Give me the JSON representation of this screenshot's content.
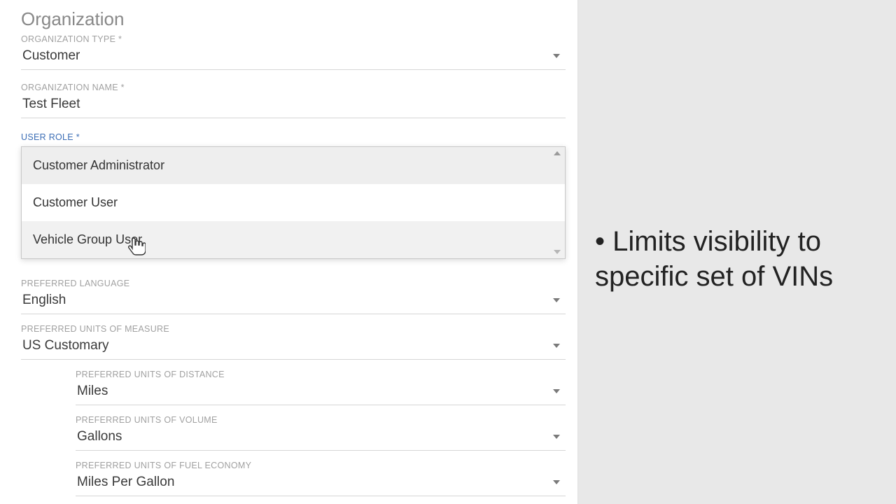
{
  "section_title": "Organization",
  "fields": {
    "org_type": {
      "label": "ORGANIZATION TYPE *",
      "value": "Customer"
    },
    "org_name": {
      "label": "ORGANIZATION NAME *",
      "value": "Test Fleet"
    },
    "user_role": {
      "label": "USER ROLE *",
      "options": [
        "Customer Administrator",
        "Customer User",
        "Vehicle Group User"
      ]
    },
    "preferred_language": {
      "label": "PREFERRED LANGUAGE",
      "value": "English"
    },
    "preferred_uom": {
      "label": "PREFERRED UNITS OF MEASURE",
      "value": "US Customary"
    },
    "preferred_distance": {
      "label": "PREFERRED UNITS OF DISTANCE",
      "value": "Miles"
    },
    "preferred_volume": {
      "label": "PREFERRED UNITS OF VOLUME",
      "value": "Gallons"
    },
    "preferred_fuel_econ": {
      "label": "PREFERRED UNITS OF FUEL ECONOMY",
      "value": "Miles Per Gallon"
    }
  },
  "annotation": "• Limits visibility to specific set of VINs",
  "colors": {
    "focus": "#3b6db5"
  }
}
